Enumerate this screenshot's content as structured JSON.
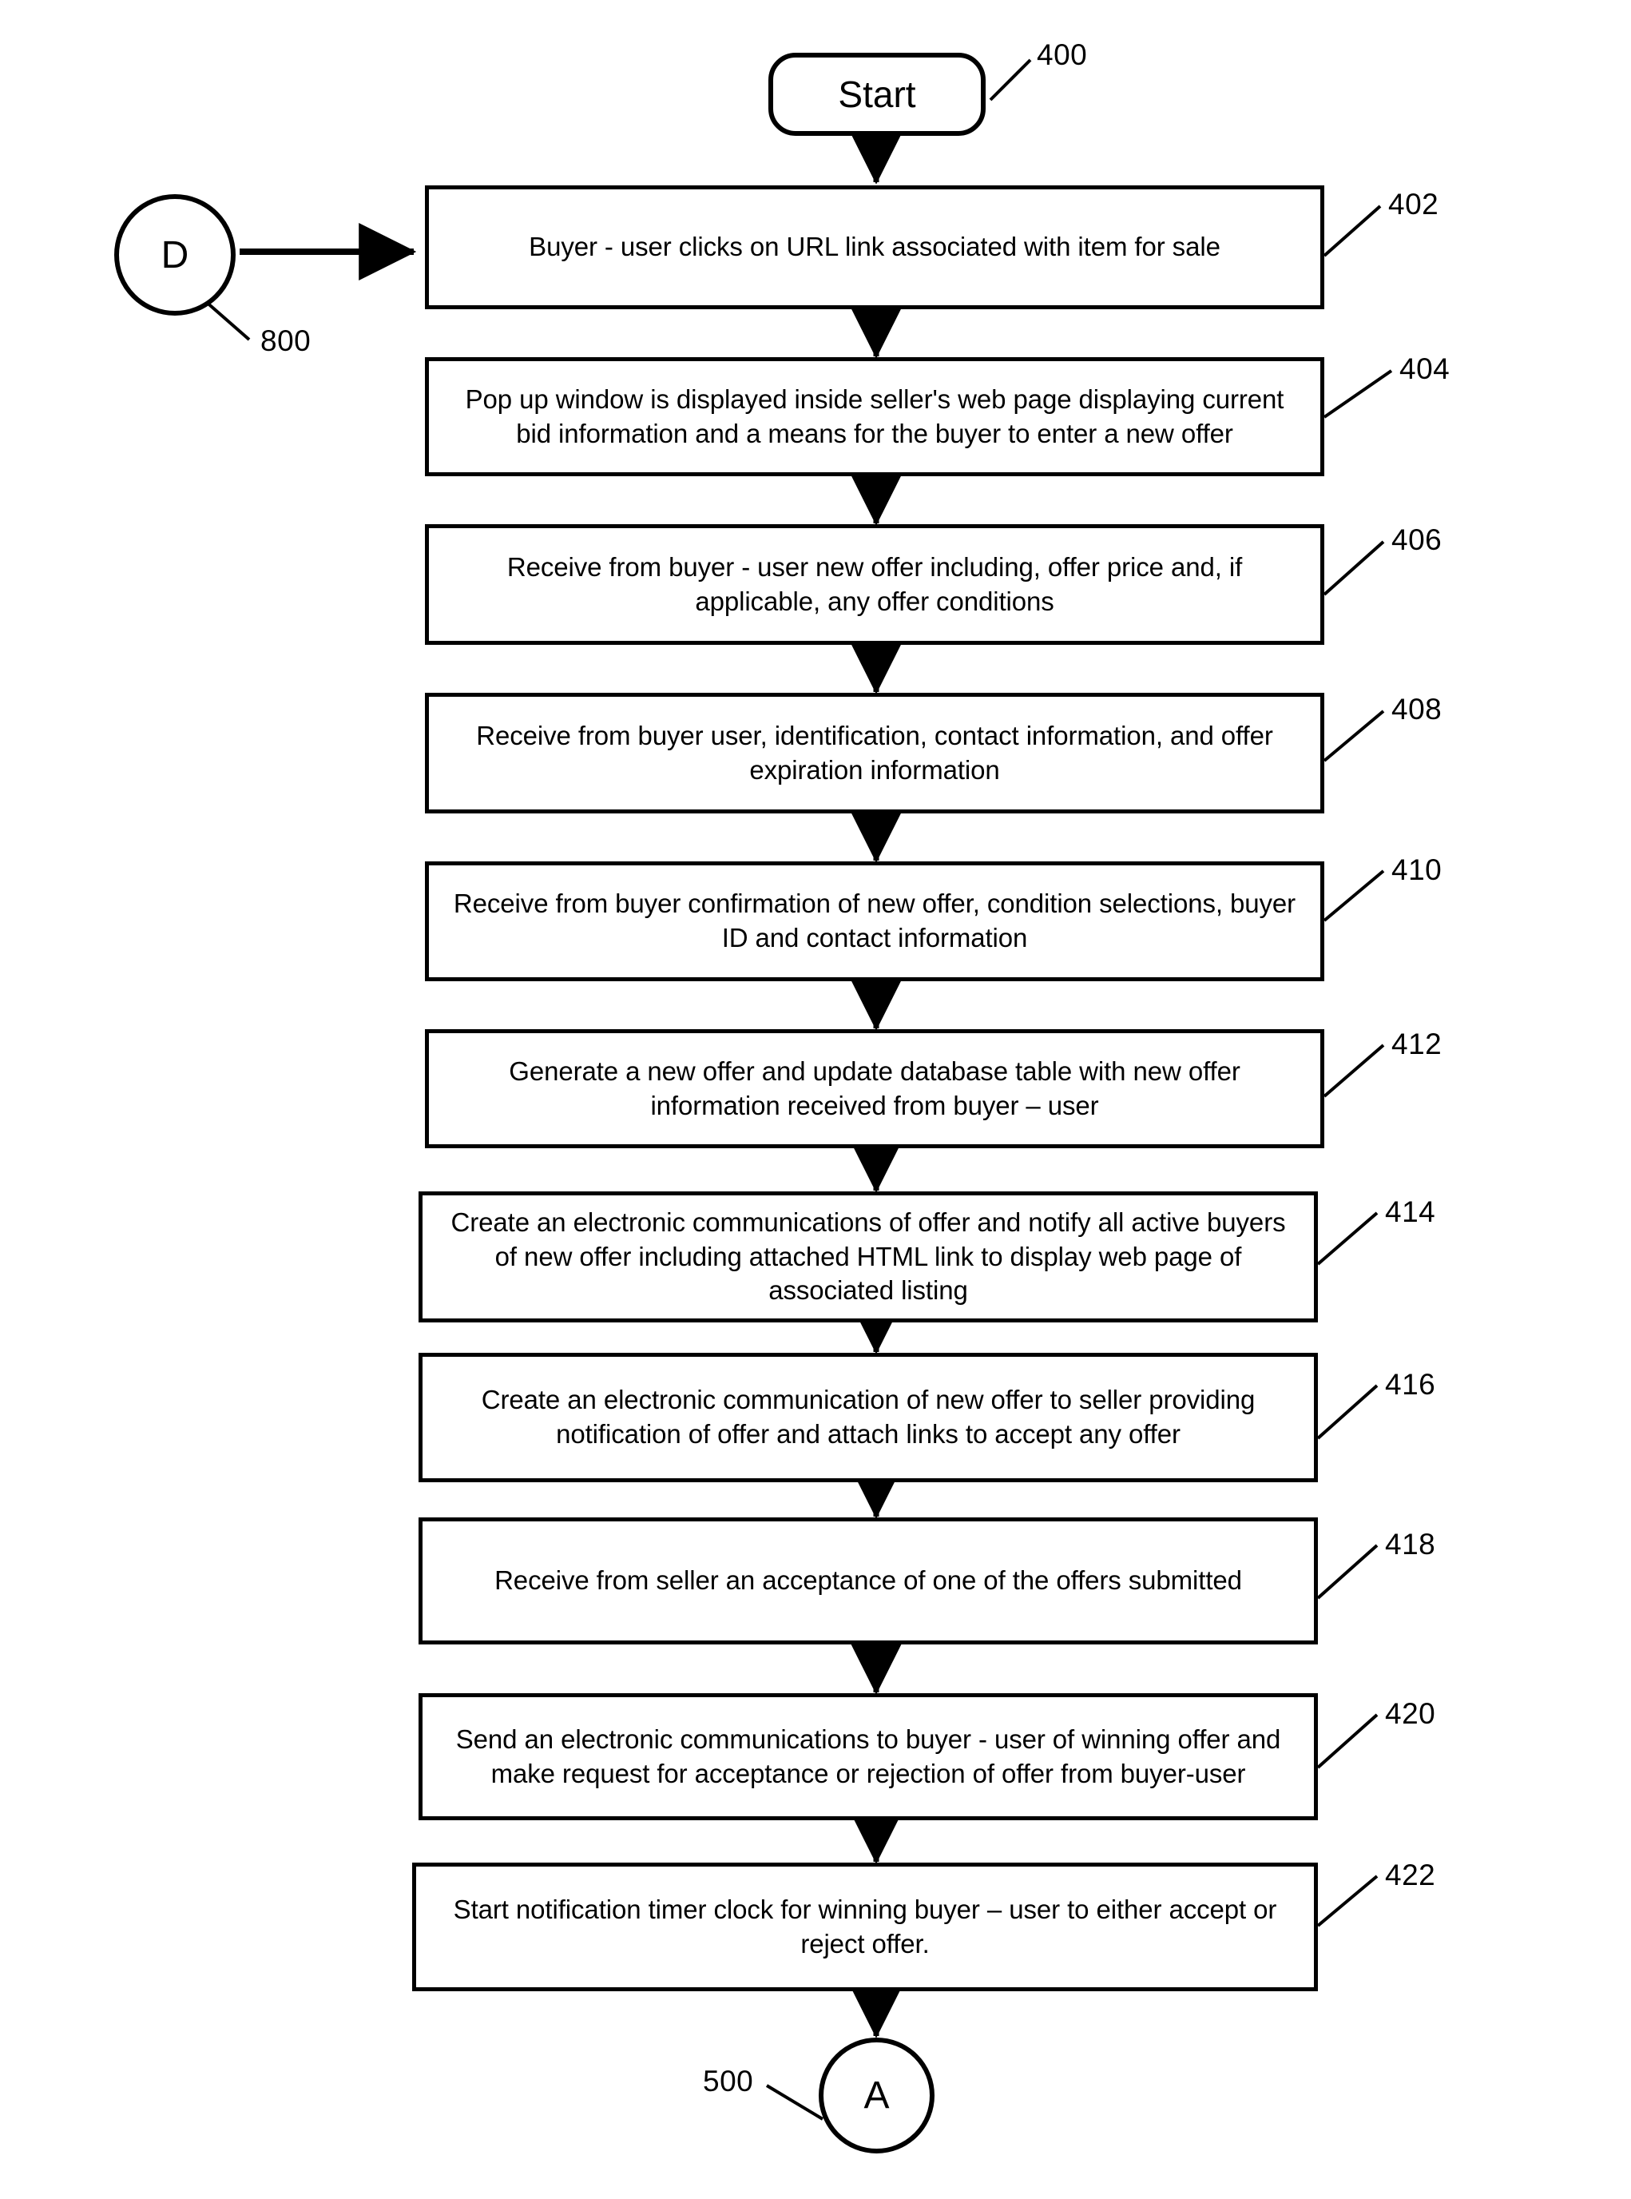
{
  "figure": {
    "type": "patent-flowchart",
    "line_color": "#000000",
    "background_color": "#ffffff"
  },
  "nodes": {
    "start": {
      "label": "Start",
      "ref": "400"
    },
    "entry_connector": {
      "label": "D",
      "ref": "800"
    },
    "end_connector": {
      "label": "A",
      "ref": "500"
    },
    "steps": [
      {
        "ref": "402",
        "text": "Buyer - user clicks on URL link associated with item for sale"
      },
      {
        "ref": "404",
        "text": "Pop up window is displayed inside seller's web page displaying current bid information and a means for the buyer to enter a new offer"
      },
      {
        "ref": "406",
        "text": "Receive from buyer - user new offer including, offer price and, if applicable, any offer conditions"
      },
      {
        "ref": "408",
        "text": "Receive from buyer user, identification, contact information, and offer expiration information"
      },
      {
        "ref": "410",
        "text": "Receive from buyer confirmation of new offer, condition selections, buyer ID and contact information"
      },
      {
        "ref": "412",
        "text": "Generate a new offer and update database table with new offer information received from buyer – user"
      },
      {
        "ref": "414",
        "text": "Create an electronic communications of offer and notify all active buyers of new offer including attached HTML link to display web page of associated listing"
      },
      {
        "ref": "416",
        "text": "Create an electronic communication of new offer to seller providing notification of offer and attach links to accept any offer"
      },
      {
        "ref": "418",
        "text": "Receive from seller an acceptance of one of the offers submitted"
      },
      {
        "ref": "420",
        "text": "Send an electronic communications to buyer -  user of winning offer and make request for acceptance or rejection of offer from buyer-user"
      },
      {
        "ref": "422",
        "text": "Start notification timer clock for winning buyer – user to either accept or reject offer."
      }
    ]
  }
}
